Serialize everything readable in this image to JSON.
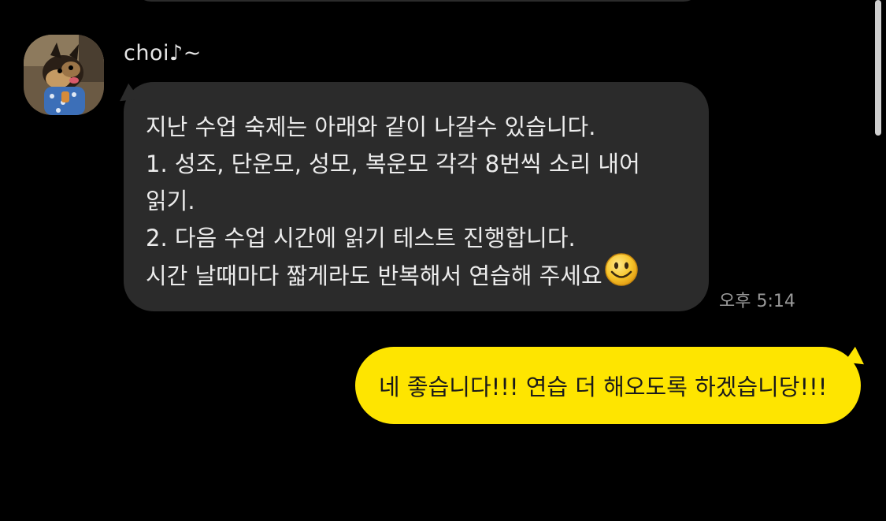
{
  "incoming": {
    "sender_name": "choi♪~",
    "lines": [
      "지난 수업 숙제는 아래와 같이 나갈수 있습니다.",
      "1.  성조, 단운모, 성모, 복운모 각각 8번씩 소리 내어",
      "읽기.",
      "2.  다음 수업 시간에 읽기 테스트 진행합니다.",
      "시간 날때마다 짧게라도 반복해서 연습해 주세요"
    ],
    "emoji": "smiley-face-emoji",
    "time": "오후 5:14"
  },
  "outgoing": {
    "text": "네 좋습니다!!! 연습 더 해오도록 하겠습니당!!!"
  },
  "colors": {
    "background": "#000000",
    "incoming_bubble": "#2b2b2b",
    "outgoing_bubble": "#fee500"
  }
}
